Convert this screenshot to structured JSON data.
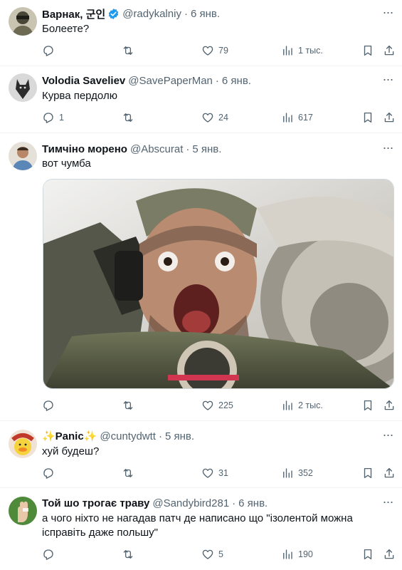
{
  "tweets": [
    {
      "name": "Варнак, 군인",
      "handle": "@radykalniy",
      "dot": "·",
      "date": "6 янв.",
      "verified": true,
      "text": "Болеете?",
      "replies": "",
      "retweets": "",
      "likes": "79",
      "views": "1 тыс.",
      "avatar_icon": "soldier-avatar"
    },
    {
      "name": "Volodia Saveliev",
      "handle": "@SavePaperMan",
      "dot": "·",
      "date": "6 янв.",
      "verified": false,
      "text": "Курва пердолю",
      "replies": "1",
      "retweets": "",
      "likes": "24",
      "views": "617",
      "avatar_icon": "wolf-avatar"
    },
    {
      "name": "Тимчіно морено",
      "handle": "@Abscurat",
      "dot": "·",
      "date": "5 янв.",
      "verified": false,
      "text": "вот чумба",
      "replies": "",
      "retweets": "",
      "likes": "225",
      "views": "2 тыс.",
      "avatar_icon": "man-avatar",
      "has_media": true
    },
    {
      "name": "✨Panic✨",
      "handle": "@cuntydwtt",
      "dot": "·",
      "date": "5 янв.",
      "verified": false,
      "text": "хуй будеш?",
      "replies": "",
      "retweets": "",
      "likes": "31",
      "views": "352",
      "avatar_icon": "duck-avatar"
    },
    {
      "name": "Той шо трогає траву",
      "handle": "@Sandybird281",
      "dot": "·",
      "date": "6 янв.",
      "verified": false,
      "text": "а чого ніхто не нагадав патч де написано що \"ізолентой можна ісправіть даже польшу\"",
      "replies": "",
      "retweets": "",
      "likes": "5",
      "views": "190",
      "avatar_icon": "hand-avatar"
    }
  ],
  "more_label": "···",
  "colors": {
    "text": "#0f1419",
    "muted": "#536471",
    "verified": "#1d9bf0",
    "border": "#eff3f4"
  }
}
